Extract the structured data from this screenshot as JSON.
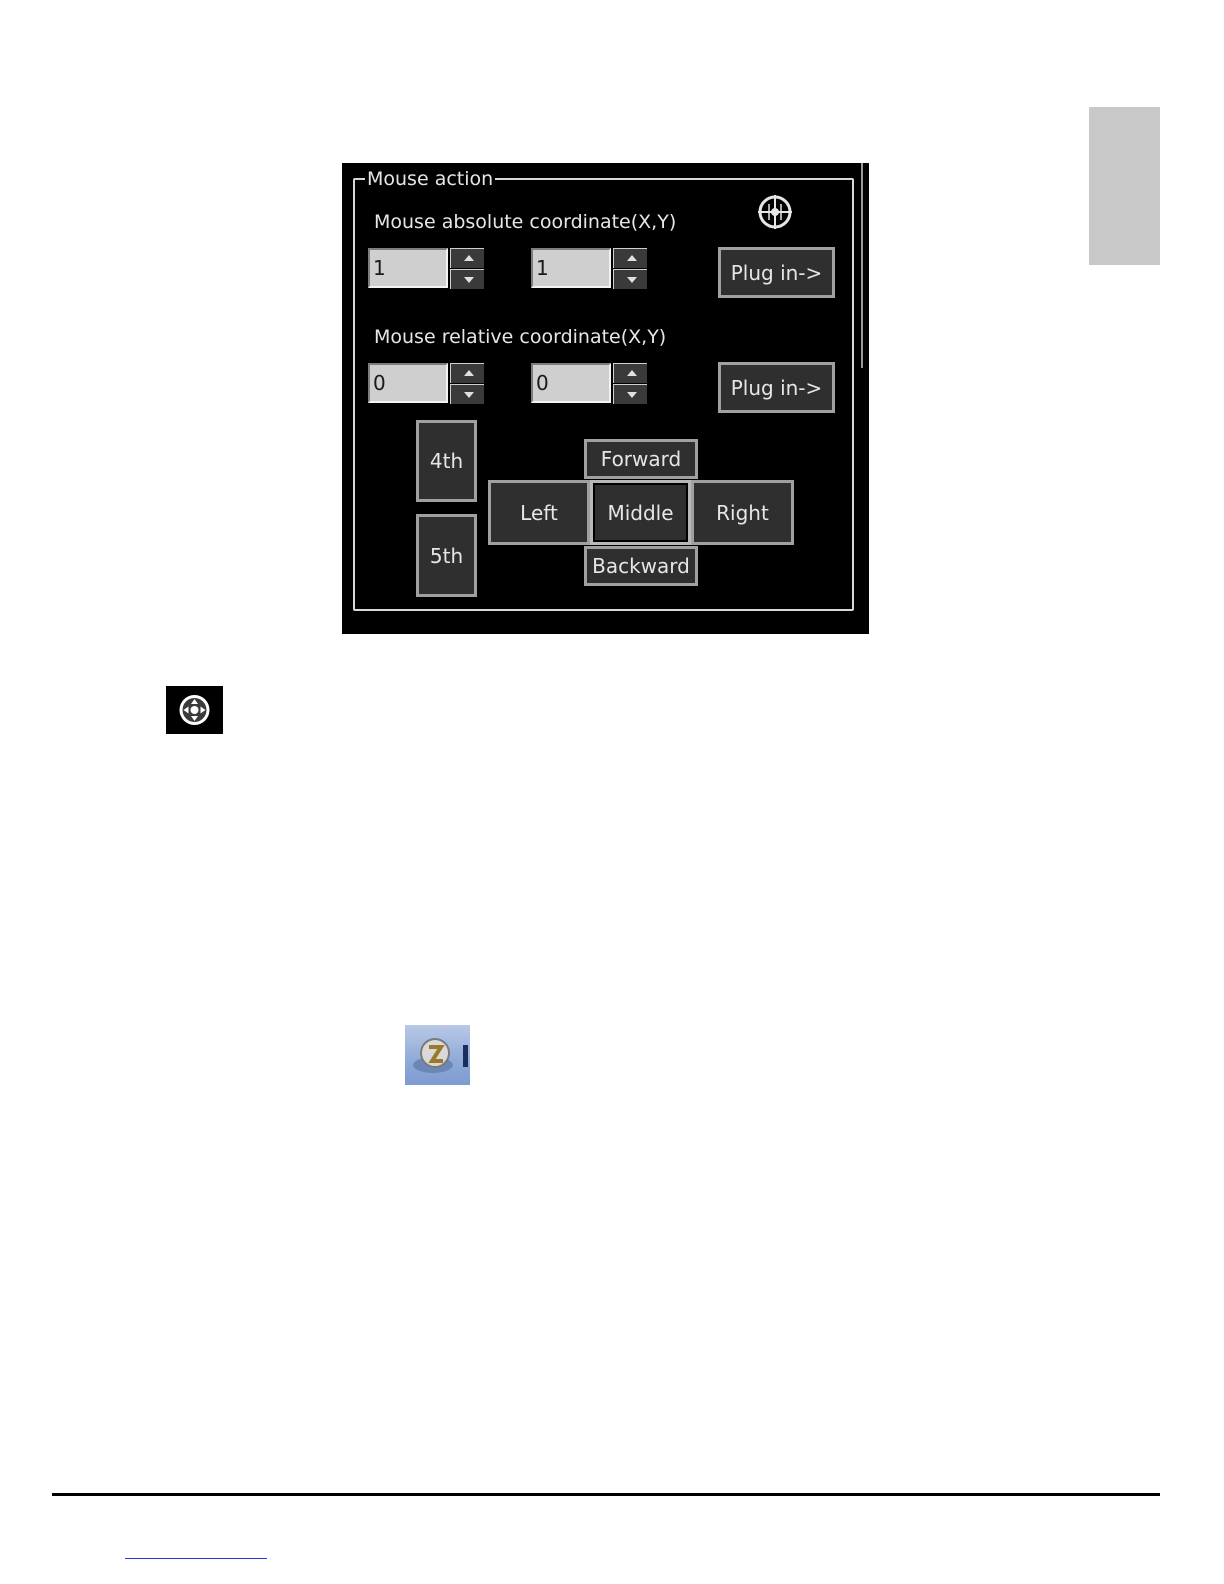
{
  "panel": {
    "group_title": "Mouse action",
    "absolute": {
      "label": "Mouse absolute coordinate(X,Y)",
      "x_value": "1",
      "y_value": "1",
      "plug_in_label": "Plug in->"
    },
    "relative": {
      "label": "Mouse relative coordinate(X,Y)",
      "x_value": "0",
      "y_value": "0",
      "plug_in_label": "Plug in->"
    },
    "buttons": {
      "fourth": "4th",
      "fifth": "5th",
      "forward": "Forward",
      "left": "Left",
      "middle": "Middle",
      "right": "Right",
      "backward": "Backward"
    },
    "icons": {
      "header": "crosshair-icon"
    }
  },
  "standalone_icons": [
    "mouse-action-icon",
    "app-icon"
  ],
  "colors": {
    "panel_bg": "#000000",
    "text": "#e6e6e6",
    "button_bg": "#2f2f2f",
    "side_tab": "#c8c8c8",
    "link": "#1a3bd4"
  }
}
